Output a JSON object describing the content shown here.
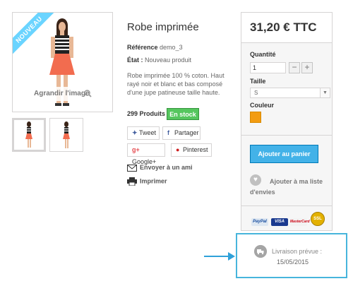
{
  "product": {
    "badge": "NOUVEAU",
    "enlarge_label": "Agrandir l'image",
    "title": "Robe imprimée",
    "reference_label": "Référence",
    "reference_value": "demo_3",
    "condition_label": "État :",
    "condition_value": "Nouveau produit",
    "description": "Robe imprimée 100 % coton. Haut rayé noir et blanc et bas composé d'une jupe patineuse taille haute.",
    "quantity_text": "299 Produits",
    "stock_label": "En stock",
    "dress_color": "#f26c4f",
    "top_color": "#222222"
  },
  "social": {
    "tweet": "Tweet",
    "share": "Partager",
    "google": "Google+",
    "pinterest": "Pinterest"
  },
  "links": {
    "send_friend": "Envoyer à un ami",
    "print": "Imprimer"
  },
  "buy_box": {
    "price": "31,20 € TTC",
    "quantity_label": "Quantité",
    "quantity_value": "1",
    "minus": "−",
    "plus": "+",
    "size_label": "Taille",
    "size_value": "S",
    "color_label": "Couleur",
    "color_value": "#f39c11",
    "add_to_cart": "Ajouter au panier",
    "wishlist": "Ajouter à ma liste d'envies"
  },
  "payments": {
    "paypal": "PayPal",
    "visa": "VISA",
    "mastercard": "MasterCard",
    "ssl": "SSL"
  },
  "delivery": {
    "label": "Livraison prévue :",
    "date": "15/05/2015"
  }
}
